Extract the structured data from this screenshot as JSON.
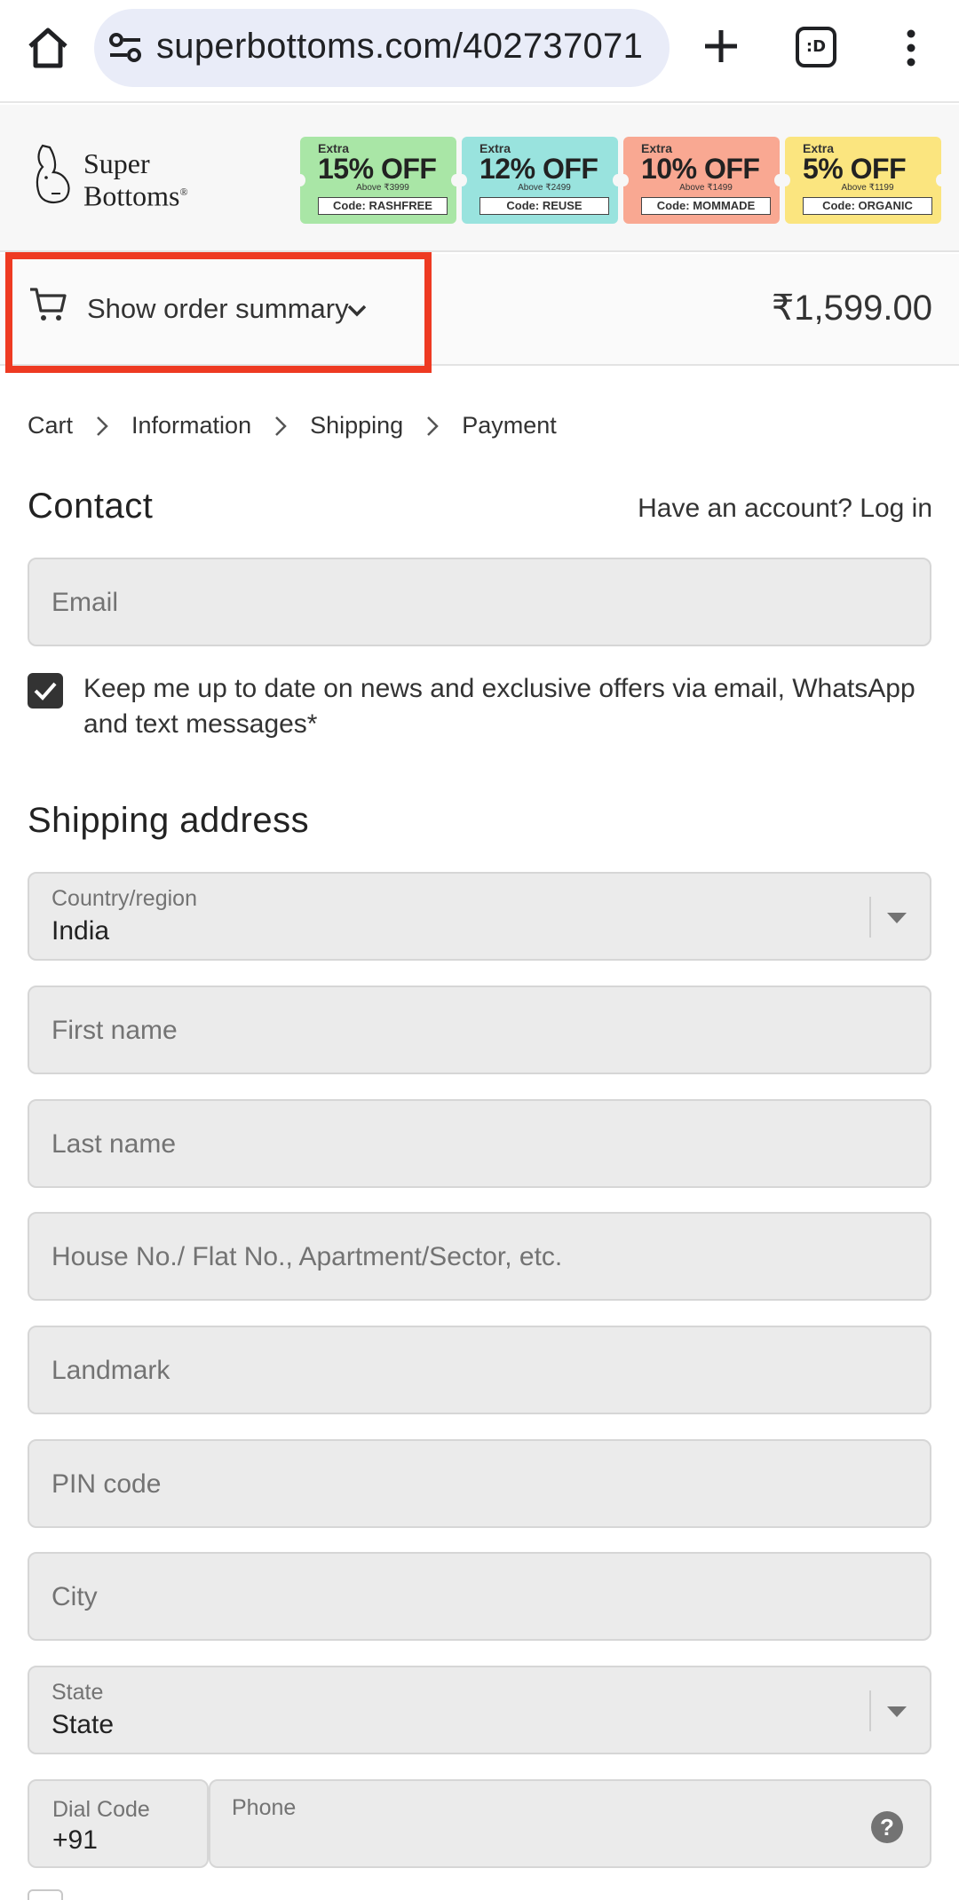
{
  "browser": {
    "url": "superbottoms.com/402737071",
    "tabs_count_label": ":D"
  },
  "store": {
    "logo_line1": "Super",
    "logo_line2": "Bottoms",
    "coupons": [
      {
        "extra": "Extra",
        "off": "15% OFF",
        "above": "Above ₹3999",
        "code": "Code: RASHFREE",
        "color": "#a9e6a6"
      },
      {
        "extra": "Extra",
        "off": "12% OFF",
        "above": "Above ₹2499",
        "code": "Code: REUSE",
        "color": "#99e3de"
      },
      {
        "extra": "Extra",
        "off": "10% OFF",
        "above": "Above ₹1499",
        "code": "Code: MOMMADE",
        "color": "#f9a892"
      },
      {
        "extra": "Extra",
        "off": "5% OFF",
        "above": "Above ₹1199",
        "code": "Code: ORGANIC",
        "color": "#fbe57f"
      }
    ]
  },
  "summary": {
    "toggle_label": "Show order summary",
    "total": "₹1,599.00",
    "highlight_color": "#ee3a22"
  },
  "breadcrumb": [
    "Cart",
    "Information",
    "Shipping",
    "Payment"
  ],
  "contact": {
    "title": "Contact",
    "login_prompt": "Have an account? Log in",
    "email_placeholder": "Email",
    "consent_text": "Keep me up to date on news and exclusive offers via email, WhatsApp and text messages*",
    "consent_checked": true
  },
  "shipping": {
    "title": "Shipping address",
    "country_label": "Country/region",
    "country_value": "India",
    "first_name": "First name",
    "last_name": "Last name",
    "address": "House No./ Flat No., Apartment/Sector, etc.",
    "landmark": "Landmark",
    "pin": "PIN code",
    "city": "City",
    "state_label": "State",
    "state_value": "State",
    "dial_label": "Dial Code",
    "dial_value": "+91",
    "phone_label": "Phone",
    "help_glyph": "?"
  }
}
